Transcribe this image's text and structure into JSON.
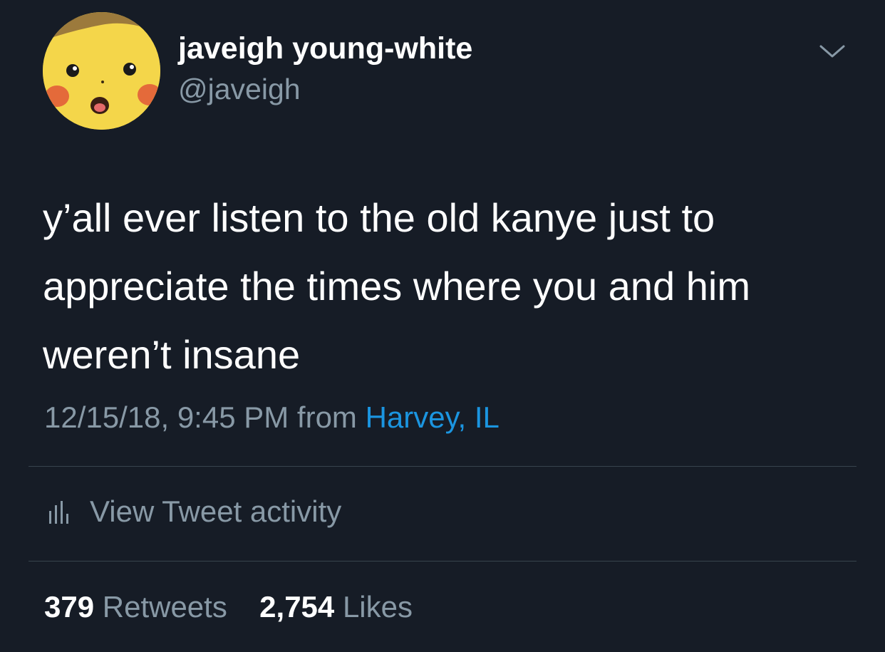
{
  "author": {
    "display_name": "javeigh young-white",
    "handle": "@javeigh",
    "avatar_icon": "surprised-pikachu-avatar"
  },
  "tweet": {
    "text_lines": [
      "y’all ever listen to the old kanye just to",
      "appreciate the times where you and him",
      "weren’t insane"
    ],
    "timestamp": "12/15/18, 9:45 PM",
    "from_label": "from",
    "location": "Harvey, IL"
  },
  "activity": {
    "label": "View Tweet activity",
    "icon": "bar-chart-icon"
  },
  "stats": {
    "retweets_count": "379",
    "retweets_label": "Retweets",
    "likes_count": "2,754",
    "likes_label": "Likes"
  },
  "colors": {
    "background": "#161c26",
    "primary_text": "#ffffff",
    "secondary_text": "#8899a6",
    "link": "#1b95e0",
    "divider": "#38444d"
  }
}
